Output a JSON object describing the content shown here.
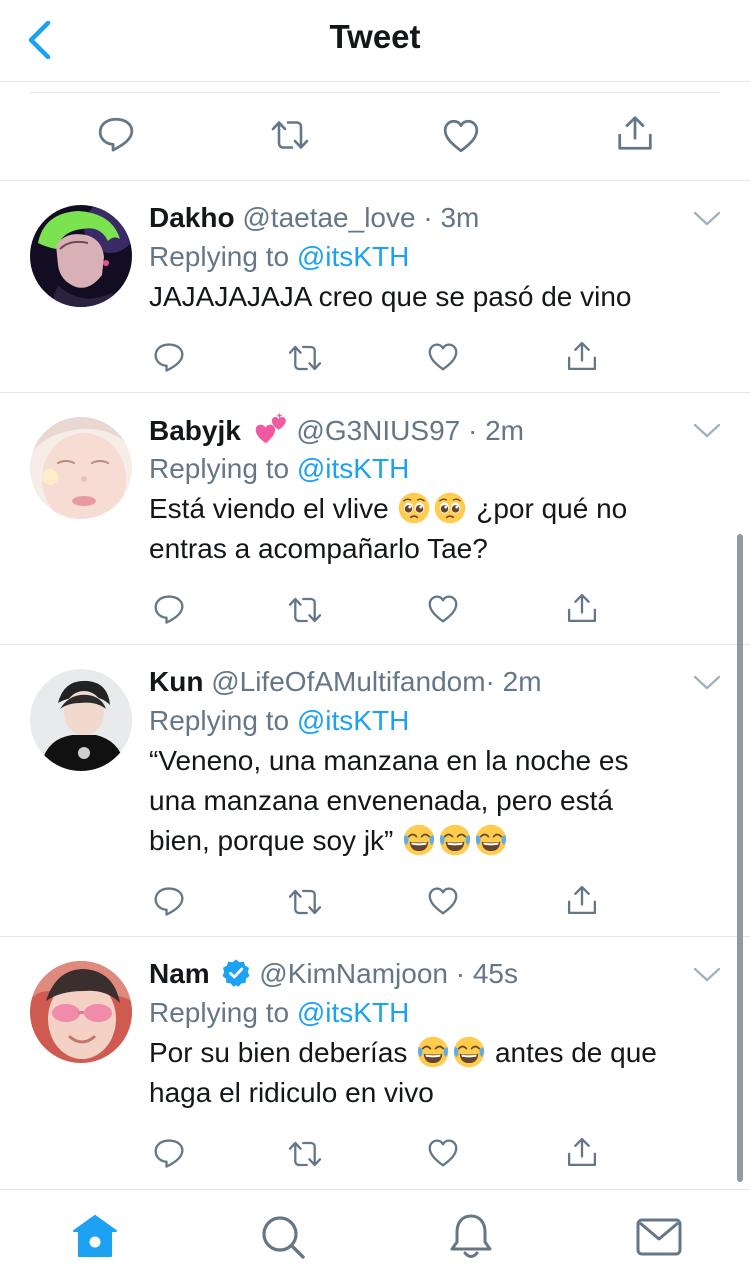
{
  "header": {
    "title": "Tweet",
    "back_icon": "chevron-left-icon"
  },
  "colors": {
    "accent": "#1da1f2",
    "secondary": "#657786",
    "text": "#14171a",
    "border": "#e1e8ed",
    "heart_emoji": "#f05aa0",
    "verified": "#1da1f2"
  },
  "main_actions": [
    "reply-icon",
    "retweet-icon",
    "like-icon",
    "share-icon"
  ],
  "replies": [
    {
      "name": "Dakho",
      "handle": "@taetae_love",
      "time": "· 3m",
      "replying_label": "Replying to",
      "replying_to": "@itsKTH",
      "lines": [
        "JAJAJAJAJA creo que se pasó de vino"
      ]
    },
    {
      "name": "Babyjk",
      "handle": "@G3NIUS97",
      "time": "· 2m",
      "replying_label": "Replying to",
      "replying_to": "@itsKTH",
      "line_a": "Está viendo el vlive",
      "line_b": "¿por qué no",
      "line_c": "entras a acompañarlo Tae?",
      "name_emoji": "two-hearts-emoji",
      "text_emoji": "pleading-face-emoji"
    },
    {
      "name": "Kun",
      "handle": "@LifeOfAMultifandom",
      "time": "· 2m",
      "replying_label": "Replying to",
      "replying_to": "@itsKTH",
      "line_a": "“Veneno, una manzana en la noche es",
      "line_b": "una manzana envenenada, pero está",
      "line_c": "bien, porque soy jk”",
      "text_emoji": "tears-of-joy-emoji"
    },
    {
      "name": "Nam",
      "handle": "@KimNamjoon",
      "time": "· 45s",
      "replying_label": "Replying to",
      "replying_to": "@itsKTH",
      "line_a": "Por su bien deberías",
      "line_b": "antes de que",
      "line_c": "haga el ridiculo en vivo",
      "name_badge": "verified-badge-icon",
      "text_emoji": "tears-of-joy-emoji"
    }
  ],
  "tabbar": [
    "home-icon",
    "search-icon",
    "notifications-icon",
    "messages-icon"
  ]
}
